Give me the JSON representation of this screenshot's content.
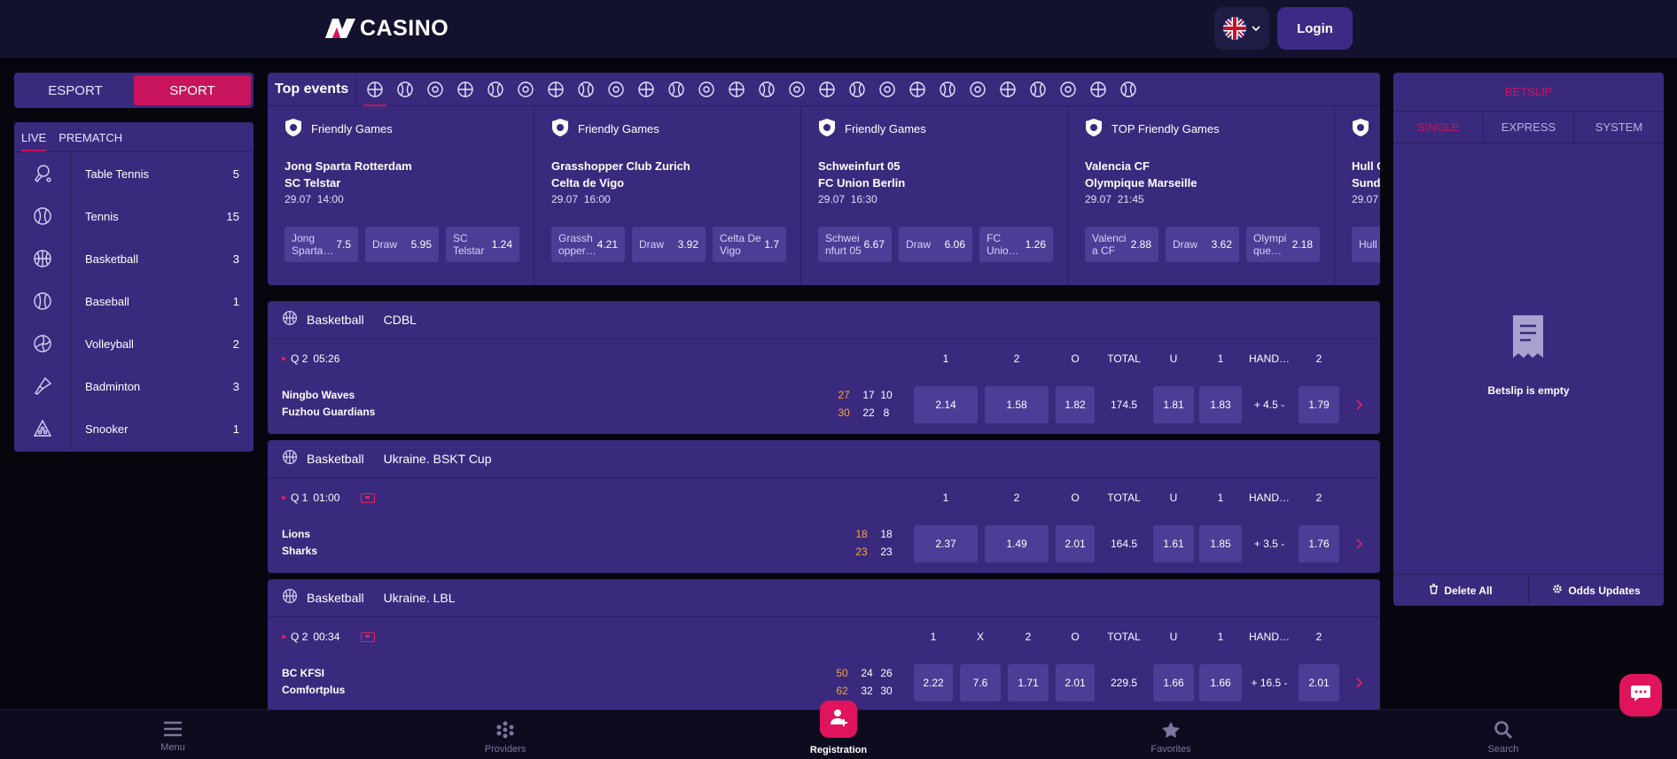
{
  "header": {
    "logo_text": "CASINO",
    "login_label": "Login",
    "language": "flag-uk-icon"
  },
  "sidebar": {
    "switch": [
      {
        "label": "ESPORT",
        "active": false
      },
      {
        "label": "SPORT",
        "active": true
      }
    ],
    "tabs": [
      {
        "label": "LIVE",
        "active": true
      },
      {
        "label": "PREMATCH",
        "active": false
      }
    ],
    "items": [
      {
        "label": "Table Tennis",
        "count": "5",
        "icon": "table-tennis-icon"
      },
      {
        "label": "Tennis",
        "count": "15",
        "icon": "tennis-icon"
      },
      {
        "label": "Basketball",
        "count": "3",
        "icon": "basketball-icon"
      },
      {
        "label": "Baseball",
        "count": "1",
        "icon": "baseball-icon"
      },
      {
        "label": "Volleyball",
        "count": "2",
        "icon": "volleyball-icon"
      },
      {
        "label": "Badminton",
        "count": "3",
        "icon": "badminton-icon"
      },
      {
        "label": "Snooker",
        "count": "1",
        "icon": "snooker-icon"
      }
    ]
  },
  "top_events": {
    "title": "Top events",
    "cards": [
      {
        "league": "Friendly Games",
        "team1": "Jong Sparta Rotterdam",
        "team2": "SC Telstar",
        "date": "29.07",
        "time": "14:00",
        "odds": [
          {
            "name": "Jong Sparta…",
            "value": "7.5"
          },
          {
            "name": "Draw",
            "value": "5.95"
          },
          {
            "name": "SC Telstar",
            "value": "1.24"
          }
        ]
      },
      {
        "league": "Friendly Games",
        "team1": "Grasshopper Club Zurich",
        "team2": "Celta de Vigo",
        "date": "29.07",
        "time": "16:00",
        "odds": [
          {
            "name": "Grassh opper…",
            "value": "4.21"
          },
          {
            "name": "Draw",
            "value": "3.92"
          },
          {
            "name": "Celta De Vigo",
            "value": "1.7"
          }
        ]
      },
      {
        "league": "Friendly Games",
        "team1": "Schweinfurt 05",
        "team2": "FC Union Berlin",
        "date": "29.07",
        "time": "16:30",
        "odds": [
          {
            "name": "Schwei nfurt 05",
            "value": "6.67"
          },
          {
            "name": "Draw",
            "value": "6.06"
          },
          {
            "name": "FC Unio…",
            "value": "1.26"
          }
        ]
      },
      {
        "league": "TOP Friendly Games",
        "team1": "Valencia CF",
        "team2": "Olympique Marseille",
        "date": "29.07",
        "time": "21:45",
        "odds": [
          {
            "name": "Valenci a CF",
            "value": "2.88"
          },
          {
            "name": "Draw",
            "value": "3.62"
          },
          {
            "name": "Olympi que…",
            "value": "2.18"
          }
        ]
      },
      {
        "league": "",
        "team1": "Hull C",
        "team2": "Sund",
        "date": "29.07",
        "time": "",
        "odds": [
          {
            "name": "Hull City",
            "value": ""
          }
        ]
      }
    ]
  },
  "matches": [
    {
      "sport": "Basketball",
      "league": "CDBL",
      "period": "Q 2",
      "clock": "05:26",
      "tv": false,
      "team1": "Ningbo Waves",
      "team2": "Fuzhou Guardians",
      "score1": [
        "27",
        "17",
        "10"
      ],
      "score2": [
        "30",
        "22",
        "8"
      ],
      "headers": [
        "1",
        "2",
        "O",
        "TOTAL",
        "U",
        "1",
        "HAND…",
        "2"
      ],
      "odds": [
        "2.14",
        "1.58",
        "1.82",
        "174.5",
        "1.81",
        "1.83",
        "+ 4.5 -",
        "1.79"
      ]
    },
    {
      "sport": "Basketball",
      "league": "Ukraine. BSKT Cup",
      "period": "Q 1",
      "clock": "01:00",
      "tv": true,
      "team1": "Lions",
      "team2": "Sharks",
      "score1": [
        "18",
        "18"
      ],
      "score2": [
        "23",
        "23"
      ],
      "headers": [
        "1",
        "2",
        "O",
        "TOTAL",
        "U",
        "1",
        "HAND…",
        "2"
      ],
      "odds": [
        "2.37",
        "1.49",
        "2.01",
        "164.5",
        "1.61",
        "1.85",
        "+ 3.5 -",
        "1.76"
      ]
    },
    {
      "sport": "Basketball",
      "league": "Ukraine. LBL",
      "period": "Q 2",
      "clock": "00:34",
      "tv": true,
      "team1": "BC KFSI",
      "team2": "Comfortplus",
      "score1": [
        "50",
        "24",
        "26"
      ],
      "score2": [
        "62",
        "32",
        "30"
      ],
      "headers": [
        "1",
        "X",
        "2",
        "O",
        "TOTAL",
        "U",
        "1",
        "HAND…",
        "2"
      ],
      "odds": [
        "2.22",
        "7.6",
        "1.71",
        "2.01",
        "229.5",
        "1.66",
        "1.66",
        "+ 16.5 -",
        "2.01"
      ]
    }
  ],
  "betslip": {
    "title": "BETSLIP",
    "tabs": [
      {
        "label": "SINGLE",
        "active": true
      },
      {
        "label": "EXPRESS",
        "active": false
      },
      {
        "label": "SYSTEM",
        "active": false
      }
    ],
    "empty_text": "Betslip is empty",
    "delete_all": "Delete All",
    "odds_updates": "Odds Updates"
  },
  "bottom_nav": [
    {
      "label": "Menu",
      "icon": "menu-icon"
    },
    {
      "label": "Providers",
      "icon": "providers-icon"
    },
    {
      "label": "Registration",
      "icon": "add-user-icon"
    },
    {
      "label": "Favorites",
      "icon": "star-icon"
    },
    {
      "label": "Search",
      "icon": "search-icon"
    }
  ],
  "colors": {
    "accent": "#c8145c",
    "panel": "#3a2a7e",
    "header": "#13122e",
    "score_current": "#f6a53a"
  }
}
